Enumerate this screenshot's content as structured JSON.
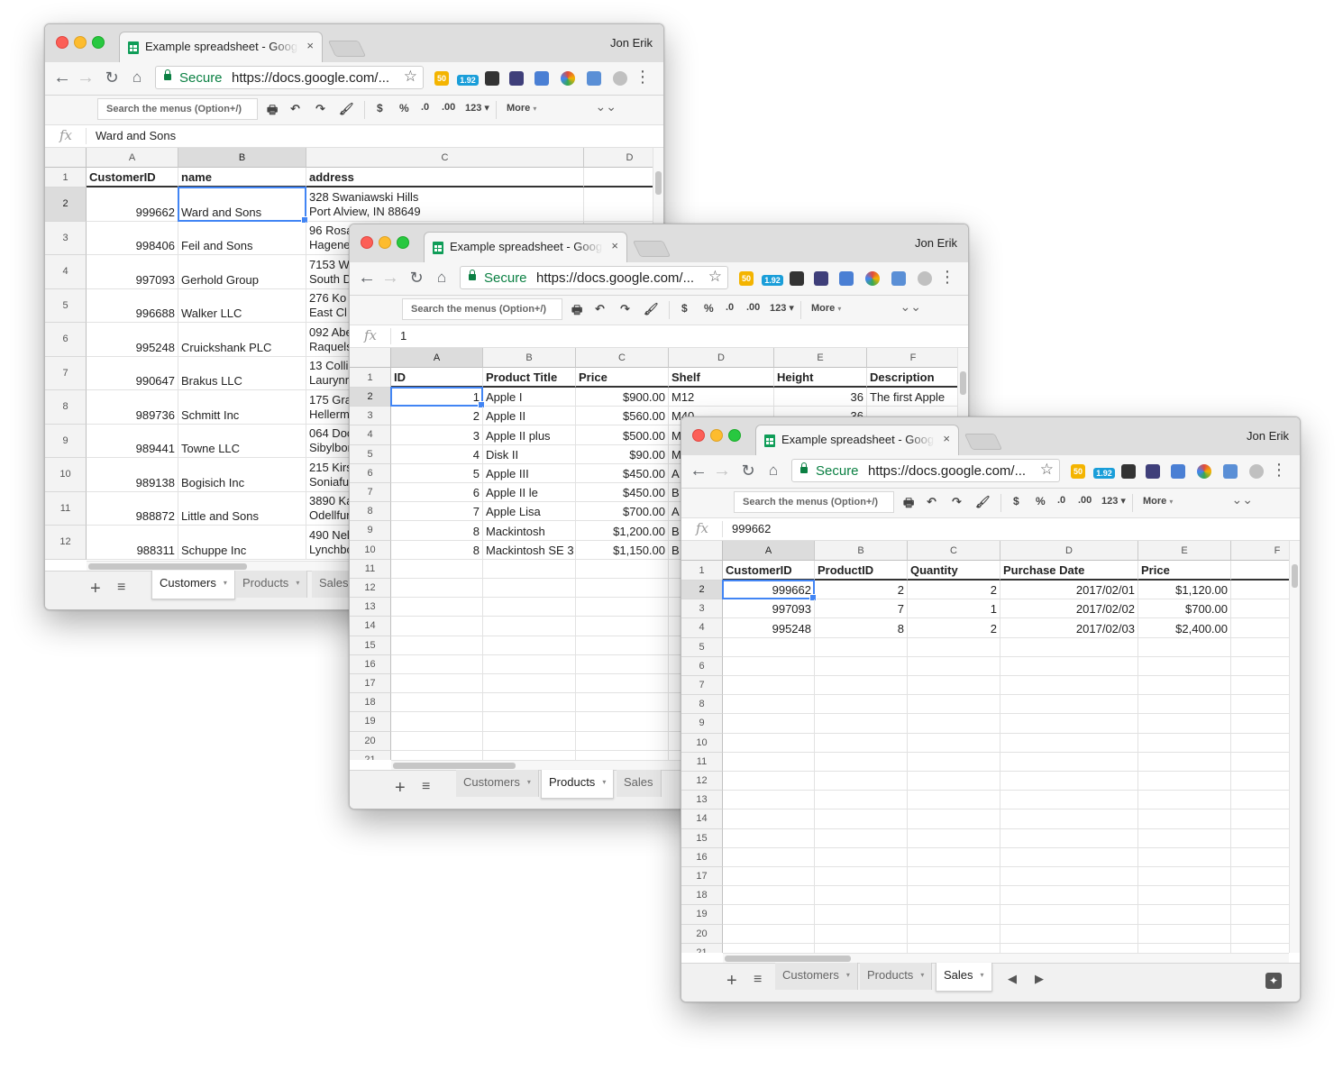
{
  "common": {
    "tab_title": "Example spreadsheet - Google Sheets",
    "tab_close": "×",
    "user_name": "Jon Erik",
    "secure_label": "Secure",
    "url": "https://docs.google.com/...",
    "search_menus_placeholder": "Search the menus (Option+/)",
    "toolbar": {
      "print": "🖶",
      "undo": "↶",
      "redo": "↷",
      "paint_format": "🖌",
      "currency": "$",
      "percent": "%",
      "decrease_decimals": ".0",
      "increase_decimals": ".00",
      "number_format": "123 ▾",
      "more": "More",
      "more_caret": "▾",
      "collapse": "⌄⌄"
    },
    "fx_symbol": "fx",
    "sheet_tabs": [
      "Customers",
      "Products",
      "Sales"
    ],
    "add_sheet": "+",
    "all_sheets": "≡",
    "tab_caret": "▾",
    "icons": {
      "back": "←",
      "forward": "→",
      "reload": "↻",
      "home": "⌂",
      "star": "☆",
      "menu": "⋮",
      "prev_sheet": "◀",
      "next_sheet": "▶",
      "explore": "✦"
    },
    "ext_labels": [
      "50",
      "1.92"
    ],
    "ext_colors": [
      "#f4b400",
      "#1a9ed9",
      "#333333",
      "#3f3f7a",
      "#4a7fd4",
      "#e24a3b",
      "#5a8fd6",
      "#c0c0c0"
    ]
  },
  "customers_window": {
    "active_sheet": "Customers",
    "formula_value": "Ward and Sons",
    "columns": [
      "A",
      "B",
      "C",
      "D"
    ],
    "header": [
      "CustomerID",
      "name",
      "address",
      ""
    ],
    "rows": [
      {
        "n": "2",
        "id": "999662",
        "name": "Ward and Sons",
        "addr1": "328 Swaniawski Hills",
        "addr2": "Port Alview, IN 88649"
      },
      {
        "n": "3",
        "id": "998406",
        "name": "Feil and Sons",
        "addr1": "96 Rosa",
        "addr2": "Hagene"
      },
      {
        "n": "4",
        "id": "997093",
        "name": "Gerhold Group",
        "addr1": "7153 W",
        "addr2": "South D"
      },
      {
        "n": "5",
        "id": "996688",
        "name": "Walker LLC",
        "addr1": "276 Ko",
        "addr2": "East Cl"
      },
      {
        "n": "6",
        "id": "995248",
        "name": "Cruickshank PLC",
        "addr1": "092 Abe",
        "addr2": "Raquels"
      },
      {
        "n": "7",
        "id": "990647",
        "name": "Brakus LLC",
        "addr1": "13 Colli",
        "addr2": "Laurynn"
      },
      {
        "n": "8",
        "id": "989736",
        "name": "Schmitt Inc",
        "addr1": "175 Gra",
        "addr2": "Hellerm"
      },
      {
        "n": "9",
        "id": "989441",
        "name": "Towne LLC",
        "addr1": "064 Doc",
        "addr2": "Sibylbor"
      },
      {
        "n": "10",
        "id": "989138",
        "name": "Bogisich Inc",
        "addr1": "215 Kirs",
        "addr2": "Soniafu"
      },
      {
        "n": "11",
        "id": "988872",
        "name": "Little and Sons",
        "addr1": "3890 Ka",
        "addr2": "Odellfur"
      },
      {
        "n": "12",
        "id": "988311",
        "name": "Schuppe Inc",
        "addr1": "490 Nel",
        "addr2": "Lynchbo"
      }
    ]
  },
  "products_window": {
    "active_sheet": "Products",
    "formula_value": "1",
    "columns": [
      "A",
      "B",
      "C",
      "D",
      "E",
      "F"
    ],
    "header": [
      "ID",
      "Product Title",
      "Price",
      "Shelf",
      "Height",
      "Description"
    ],
    "rows": [
      {
        "n": "2",
        "cells": [
          "1",
          "Apple I",
          "$900.00",
          "M12",
          "36",
          "The first Apple"
        ]
      },
      {
        "n": "3",
        "cells": [
          "2",
          "Apple II",
          "$560.00",
          "M40",
          "36",
          ""
        ]
      },
      {
        "n": "4",
        "cells": [
          "3",
          "Apple II plus",
          "$500.00",
          "M",
          "",
          ""
        ]
      },
      {
        "n": "5",
        "cells": [
          "4",
          "Disk II",
          "$90.00",
          "M",
          "",
          ""
        ]
      },
      {
        "n": "6",
        "cells": [
          "5",
          "Apple III",
          "$450.00",
          "A",
          "",
          ""
        ]
      },
      {
        "n": "7",
        "cells": [
          "6",
          "Apple II le",
          "$450.00",
          "B",
          "",
          ""
        ]
      },
      {
        "n": "8",
        "cells": [
          "7",
          "Apple Lisa",
          "$700.00",
          "A",
          "",
          ""
        ]
      },
      {
        "n": "9",
        "cells": [
          "8",
          "Mackintosh",
          "$1,200.00",
          "B",
          "",
          ""
        ]
      },
      {
        "n": "10",
        "cells": [
          "8",
          "Mackintosh SE 3",
          "$1,150.00",
          "B",
          "",
          ""
        ]
      }
    ],
    "empty_rows": [
      "11",
      "12",
      "13",
      "14",
      "15",
      "16",
      "17",
      "18",
      "19",
      "20",
      "21"
    ]
  },
  "sales_window": {
    "active_sheet": "Sales",
    "formula_value": "999662",
    "columns": [
      "A",
      "B",
      "C",
      "D",
      "E",
      "F"
    ],
    "header": [
      "CustomerID",
      "ProductID",
      "Quantity",
      "Purchase Date",
      "Price",
      ""
    ],
    "rows": [
      {
        "n": "2",
        "cells": [
          "999662",
          "2",
          "2",
          "2017/02/01",
          "$1,120.00",
          ""
        ]
      },
      {
        "n": "3",
        "cells": [
          "997093",
          "7",
          "1",
          "2017/02/02",
          "$700.00",
          ""
        ]
      },
      {
        "n": "4",
        "cells": [
          "995248",
          "8",
          "2",
          "2017/02/03",
          "$2,400.00",
          ""
        ]
      }
    ],
    "empty_rows": [
      "5",
      "6",
      "7",
      "8",
      "9",
      "10",
      "11",
      "12",
      "13",
      "14",
      "15",
      "16",
      "17",
      "18",
      "19",
      "20",
      "21"
    ]
  }
}
